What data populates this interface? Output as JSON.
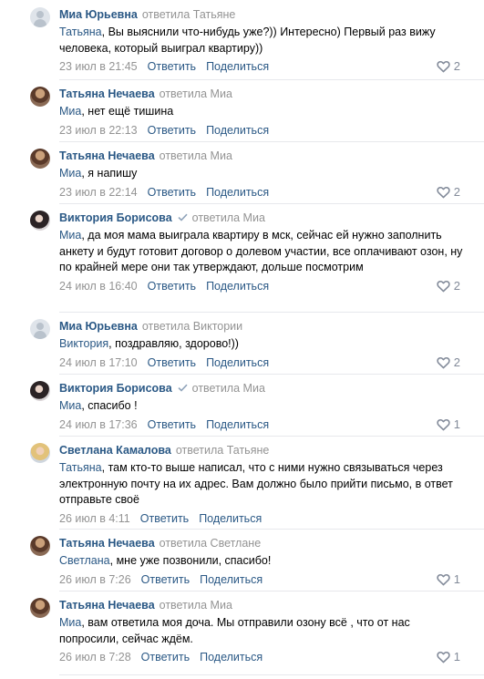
{
  "comments": [
    {
      "author": "Миа Юрьевна",
      "verb": "ответила",
      "addressee": "Татьяне",
      "verified": false,
      "mention": "Татьяна",
      "text": ", Вы выяснили что-нибудь уже?)) Интересно) Первый раз вижу человека, который выиграл квартиру))",
      "date": "23 июл в 21:45",
      "reply_label": "Ответить",
      "share_label": "Поделиться",
      "likes": "2",
      "avatar": "placeholder"
    },
    {
      "author": "Татьяна Нечаева",
      "verb": "ответила",
      "addressee": "Миа",
      "verified": false,
      "mention": "Миа",
      "text": ", нет ещё тишина",
      "date": "23 июл в 22:13",
      "reply_label": "Ответить",
      "share_label": "Поделиться",
      "likes": "",
      "avatar": "photo-tatiana"
    },
    {
      "author": "Татьяна Нечаева",
      "verb": "ответила",
      "addressee": "Миа",
      "verified": false,
      "mention": "Миа",
      "text": ", я напишу",
      "date": "23 июл в 22:14",
      "reply_label": "Ответить",
      "share_label": "Поделиться",
      "likes": "2",
      "avatar": "photo-tatiana"
    },
    {
      "author": "Виктория Борисова",
      "verb": "ответила",
      "addressee": "Миа",
      "verified": true,
      "mention": "Миа",
      "text": ", да моя мама выиграла квартиру в мск, сейчас ей нужно заполнить анкету и будут готовит договор о долевом участии, все оплачивают озон, ну по крайней мере они так утверждают, дольше посмотрим",
      "date": "24 июл в 16:40",
      "reply_label": "Ответить",
      "share_label": "Поделиться",
      "likes": "2",
      "avatar": "photo-victoria"
    },
    {
      "author": "Миа Юрьевна",
      "verb": "ответила",
      "addressee": "Виктории",
      "verified": false,
      "mention": "Виктория",
      "text": ", поздравляю, здорово!))",
      "date": "24 июл в 17:10",
      "reply_label": "Ответить",
      "share_label": "Поделиться",
      "likes": "2",
      "avatar": "placeholder"
    },
    {
      "author": "Виктория Борисова",
      "verb": "ответила",
      "addressee": "Миа",
      "verified": true,
      "mention": "Миа",
      "text": ", спасибо !",
      "date": "24 июл в 17:36",
      "reply_label": "Ответить",
      "share_label": "Поделиться",
      "likes": "1",
      "avatar": "photo-victoria"
    },
    {
      "author": "Светлана Камалова",
      "verb": "ответила",
      "addressee": "Татьяне",
      "verified": false,
      "mention": "Татьяна",
      "text": ", там кто-то выше написал, что с ними нужно связываться через электронную почту на их адрес. Вам должно было прийти письмо, в ответ отправьте своё",
      "date": "26 июл в 4:11",
      "reply_label": "Ответить",
      "share_label": "Поделиться",
      "likes": "",
      "avatar": "photo-svetlana"
    },
    {
      "author": "Татьяна Нечаева",
      "verb": "ответила",
      "addressee": "Светлане",
      "verified": false,
      "mention": "Светлана",
      "text": ", мне уже позвонили, спасибо!",
      "date": "26 июл в 7:26",
      "reply_label": "Ответить",
      "share_label": "Поделиться",
      "likes": "1",
      "avatar": "photo-tatiana"
    },
    {
      "author": "Татьяна Нечаева",
      "verb": "ответила",
      "addressee": "Миа",
      "verified": false,
      "mention": "Миа",
      "text": ", вам ответила моя доча. Мы отправили озону всё , что от нас попросили, сейчас ждём.",
      "date": "26 июл в 7:28",
      "reply_label": "Ответить",
      "share_label": "Поделиться",
      "likes": "1",
      "avatar": "photo-tatiana"
    }
  ],
  "colors": {
    "author": "#2a5885",
    "muted": "#939393",
    "divider": "#e7e8ec",
    "like_count": "#828a99"
  },
  "icons": {
    "like": "heart-outline-icon",
    "verified": "checkmark-icon",
    "avatar_placeholder": "user-silhouette-icon"
  }
}
